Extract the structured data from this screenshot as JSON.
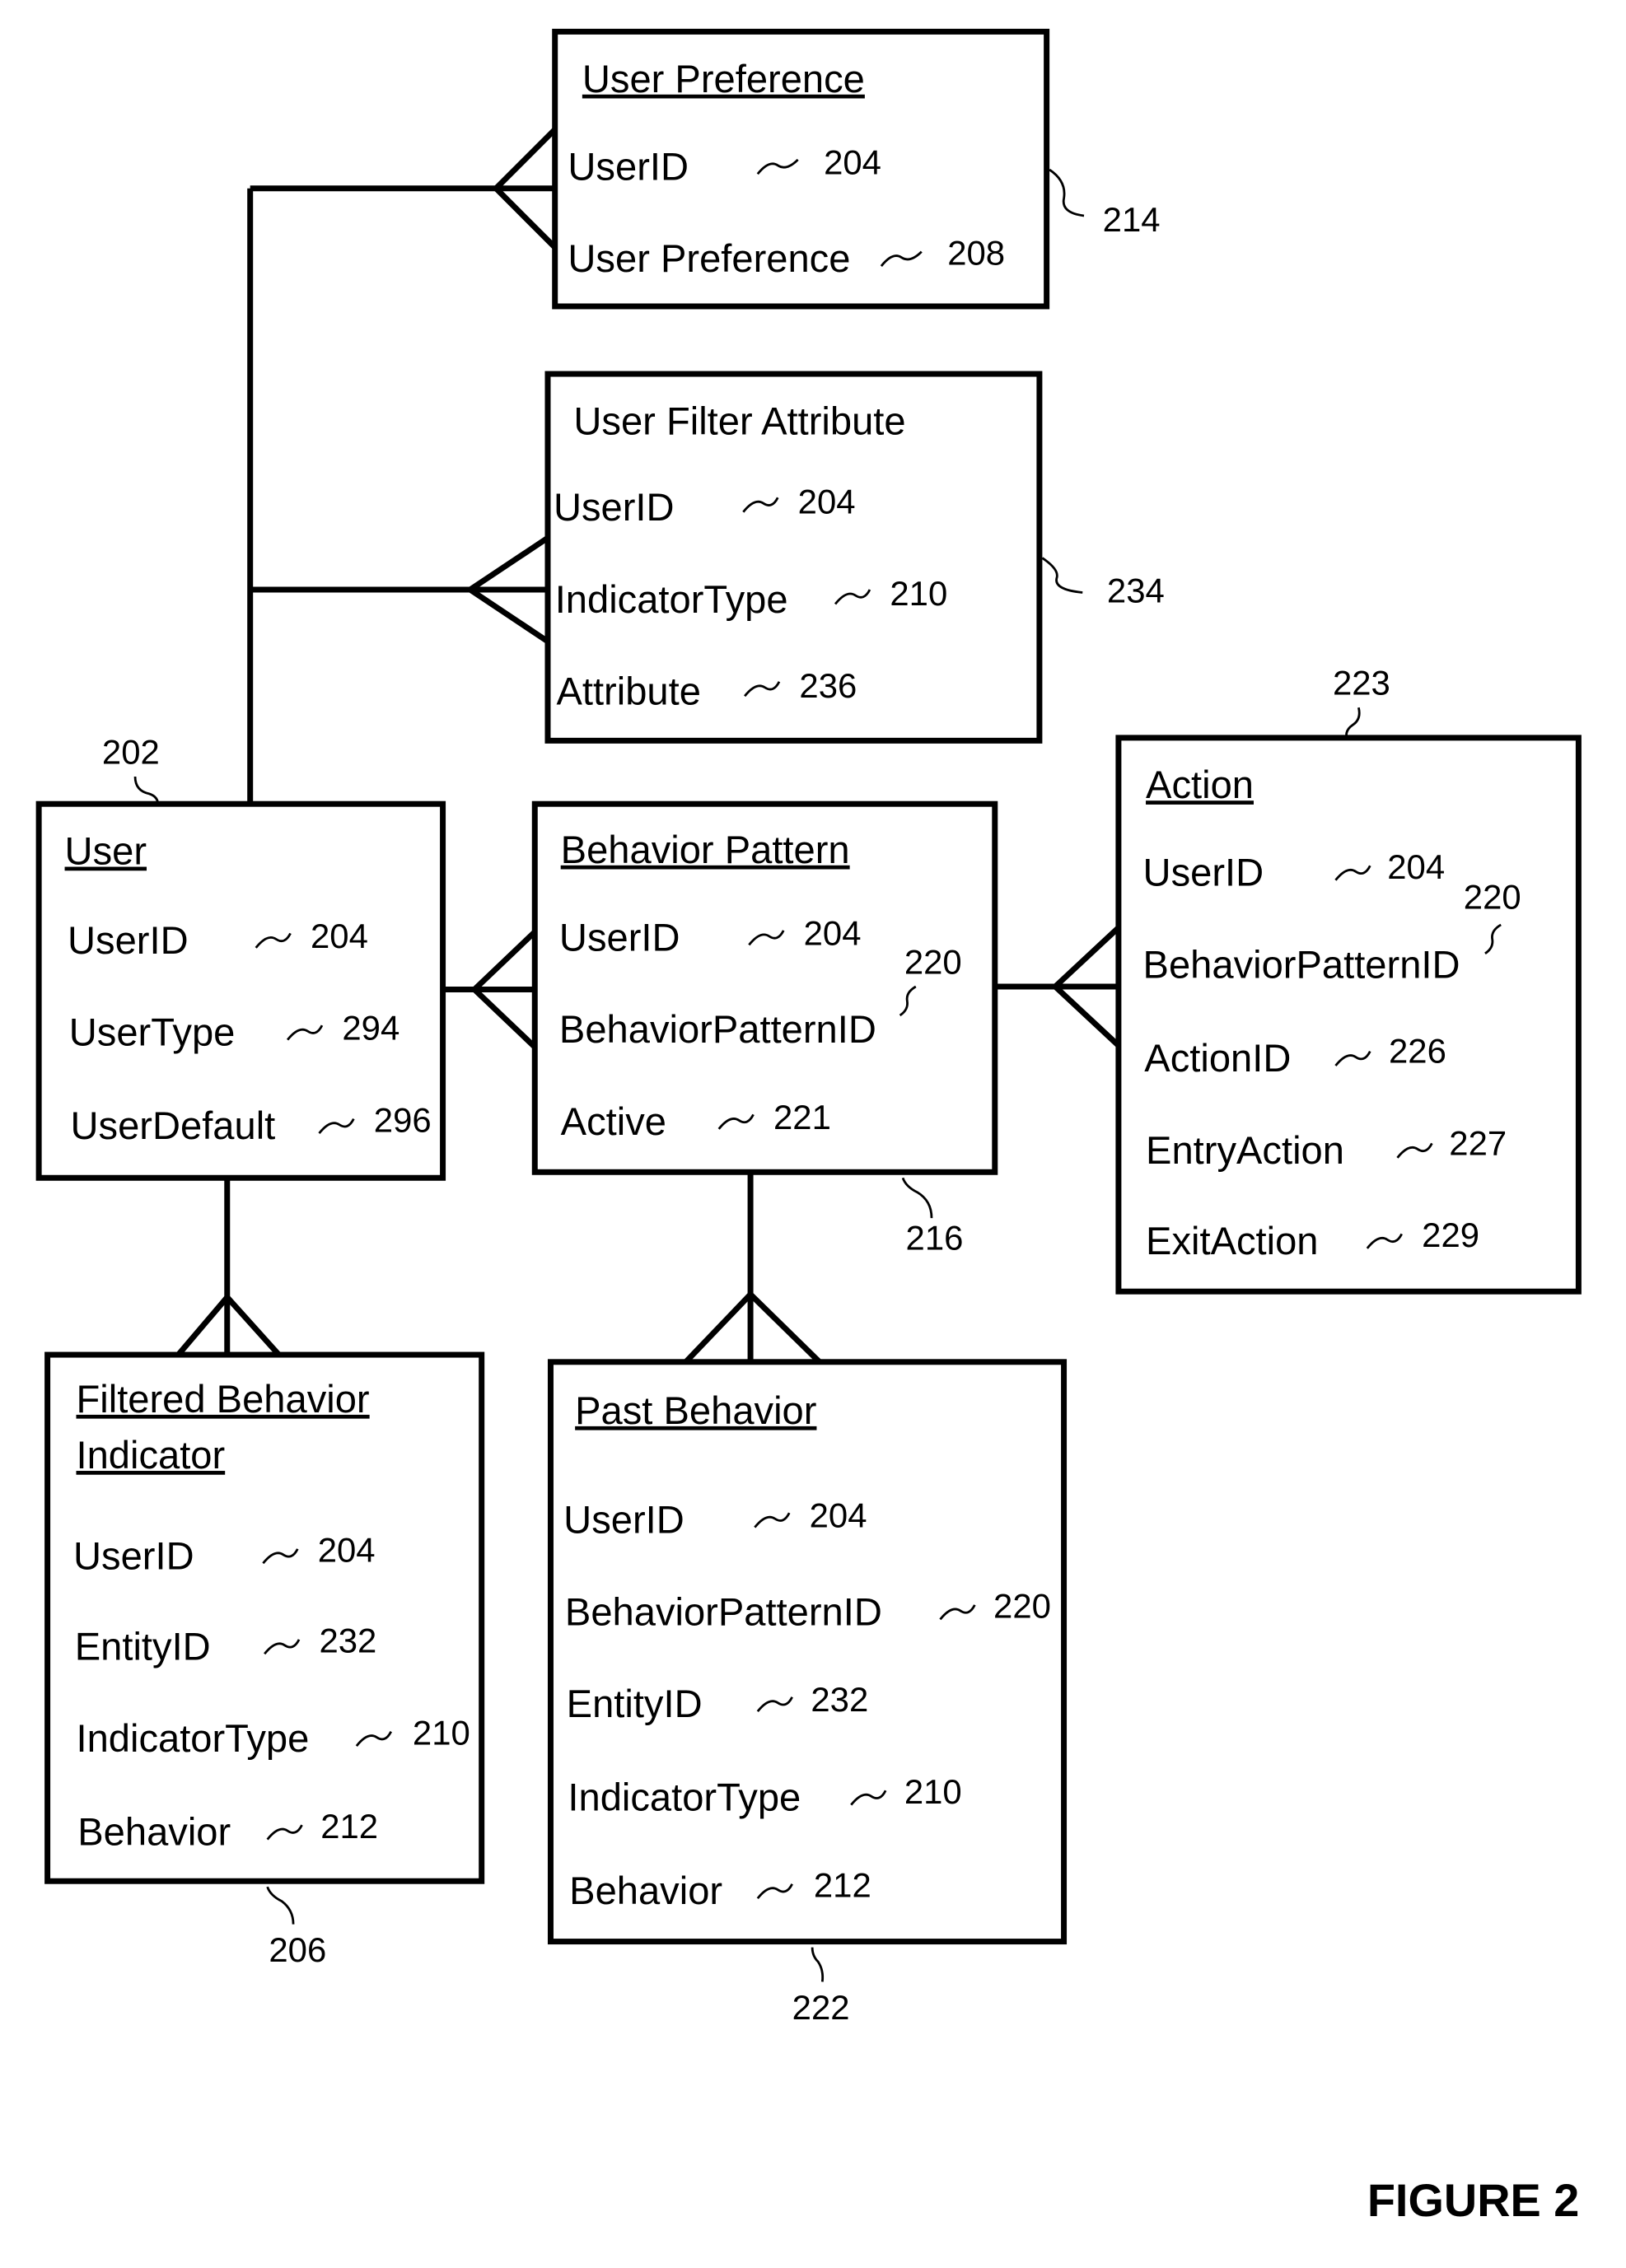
{
  "figure_label": "FIGURE 2",
  "entities": {
    "user_preference": {
      "title": "User Preference",
      "ref": "214",
      "fields": [
        {
          "name": "UserID",
          "ref": "204"
        },
        {
          "name": "User Preference",
          "ref": "208"
        }
      ]
    },
    "user_filter_attribute": {
      "title": "User Filter Attribute",
      "ref": "234",
      "fields": [
        {
          "name": "UserID",
          "ref": "204"
        },
        {
          "name": "IndicatorType",
          "ref": "210"
        },
        {
          "name": "Attribute",
          "ref": "236"
        }
      ]
    },
    "user": {
      "title": "User",
      "ref": "202",
      "fields": [
        {
          "name": "UserID",
          "ref": "204"
        },
        {
          "name": "UserType",
          "ref": "294"
        },
        {
          "name": "UserDefault",
          "ref": "296"
        }
      ]
    },
    "behavior_pattern": {
      "title": "Behavior Pattern",
      "ref": "216",
      "fields": [
        {
          "name": "UserID",
          "ref": "204"
        },
        {
          "name": "BehaviorPatternID",
          "ref": "220"
        },
        {
          "name": "Active",
          "ref": "221"
        }
      ]
    },
    "action": {
      "title": "Action",
      "ref": "223",
      "fields": [
        {
          "name": "UserID",
          "ref": "204"
        },
        {
          "name": "BehaviorPatternID",
          "ref": "220"
        },
        {
          "name": "ActionID",
          "ref": "226"
        },
        {
          "name": "EntryAction",
          "ref": "227"
        },
        {
          "name": "ExitAction",
          "ref": "229"
        }
      ]
    },
    "filtered_behavior_indicator": {
      "title_line1": "Filtered Behavior",
      "title_line2": "Indicator",
      "ref": "206",
      "fields": [
        {
          "name": "UserID",
          "ref": "204"
        },
        {
          "name": "EntityID",
          "ref": "232"
        },
        {
          "name": "IndicatorType",
          "ref": "210"
        },
        {
          "name": "Behavior",
          "ref": "212"
        }
      ]
    },
    "past_behavior": {
      "title": "Past Behavior",
      "ref": "222",
      "fields": [
        {
          "name": "UserID",
          "ref": "204"
        },
        {
          "name": "BehaviorPatternID",
          "ref": "220"
        },
        {
          "name": "EntityID",
          "ref": "232"
        },
        {
          "name": "IndicatorType",
          "ref": "210"
        },
        {
          "name": "Behavior",
          "ref": "212"
        }
      ]
    }
  },
  "relationships": [
    {
      "from": "User",
      "to": "User Preference",
      "cardinality": "one-to-many"
    },
    {
      "from": "User",
      "to": "User Filter Attribute",
      "cardinality": "one-to-many"
    },
    {
      "from": "User",
      "to": "Behavior Pattern",
      "cardinality": "one-to-many"
    },
    {
      "from": "Behavior Pattern",
      "to": "Action",
      "cardinality": "one-to-many"
    },
    {
      "from": "User",
      "to": "Filtered Behavior Indicator",
      "cardinality": "one-to-many"
    },
    {
      "from": "Behavior Pattern",
      "to": "Past Behavior",
      "cardinality": "one-to-many"
    }
  ]
}
